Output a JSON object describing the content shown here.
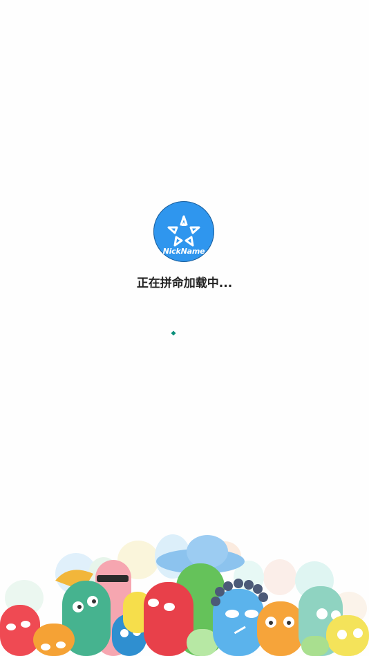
{
  "splash": {
    "logo": {
      "brand_text": "NickName",
      "icon": "star-logo-icon",
      "background_color": "#2f96ee"
    },
    "loading_text": "正在拼命加载中...",
    "spinner": {
      "icon": "loading-spinner-icon",
      "color": "#0a8f7a"
    },
    "illustration": {
      "icon": "cartoon-crowd-illustration"
    }
  }
}
